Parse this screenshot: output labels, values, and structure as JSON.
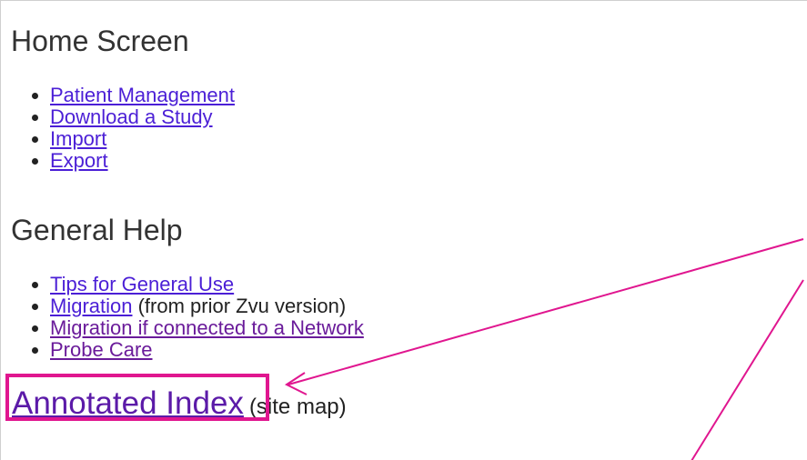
{
  "home": {
    "title": "Home Screen",
    "items": [
      {
        "label": "Patient Management"
      },
      {
        "label": "Download a Study"
      },
      {
        "label": "Import"
      },
      {
        "label": "Export"
      }
    ]
  },
  "general_help": {
    "title": "General Help",
    "items": [
      {
        "label": "Tips for General Use",
        "suffix": ""
      },
      {
        "label": "Migration",
        "suffix": " (from prior Zvu version)"
      },
      {
        "label": "Migration if connected to a Network",
        "suffix": ""
      },
      {
        "label": "Probe Care",
        "suffix": ""
      }
    ]
  },
  "index": {
    "link_label": "Annotated Index",
    "note": "(site map)"
  },
  "annotation": {
    "color": "#e0168f"
  }
}
